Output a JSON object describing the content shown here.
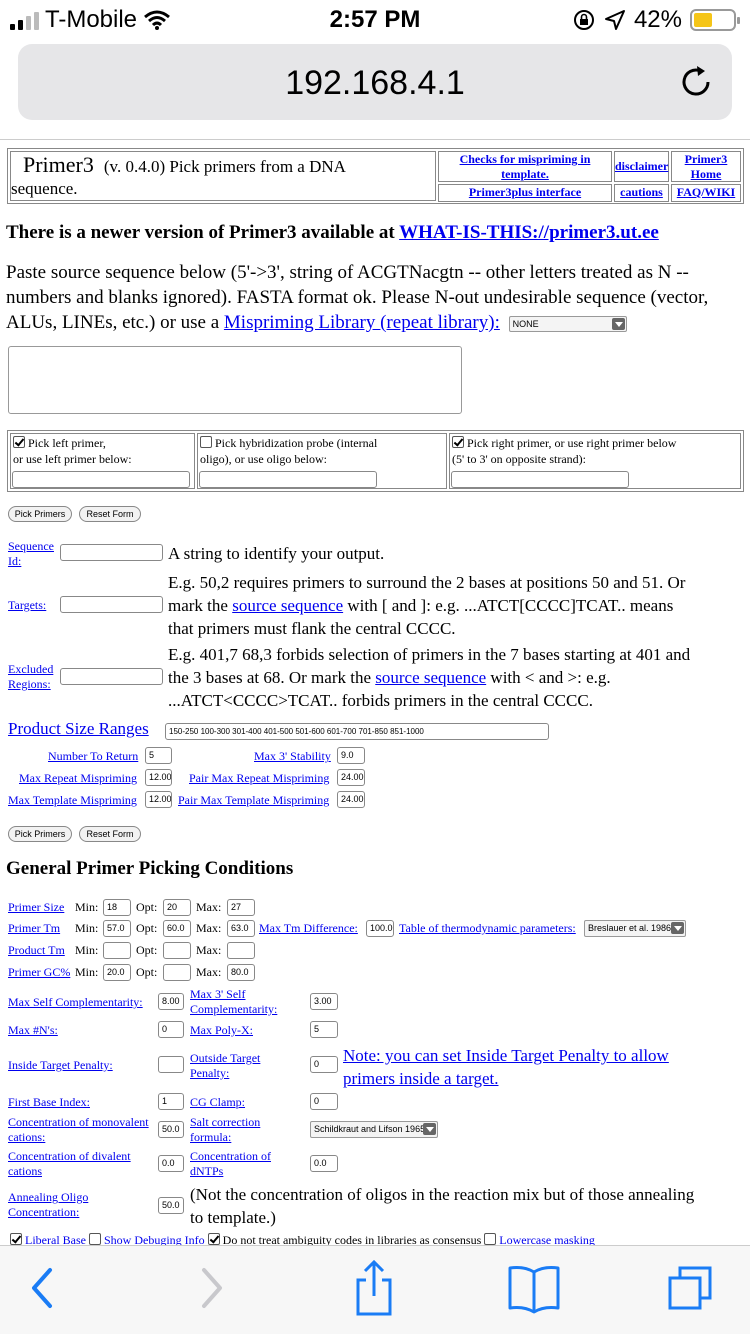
{
  "status": {
    "carrier": "T-Mobile",
    "time": "2:57 PM",
    "battery": "42%",
    "battery_level": 0.42
  },
  "browser": {
    "url": "192.168.4.1"
  },
  "header": {
    "app": "Primer3",
    "version": "(v. 0.4.0) Pick primers from a DNA",
    "version2": "sequence.",
    "link_mispriming": "Checks for mispriming in template.",
    "link_disclaimer": "disclaimer",
    "link_home": "Primer3 Home",
    "link_plus": "Primer3plus interface",
    "link_cautions": "cautions",
    "link_faq": "FAQ/WIKI"
  },
  "notice": {
    "text": "There is a newer version of Primer3 available at ",
    "link": "WHAT-IS-THIS://primer3.ut.ee"
  },
  "paste": {
    "text": "Paste source sequence below (5'->3', string of ACGTNacgtn -- other letters treated as N -- numbers and blanks ignored). FASTA format ok. Please N-out undesirable sequence (vector, ALUs, LINEs, etc.) or use a ",
    "link": "Mispriming Library (repeat library):",
    "library_value": "NONE"
  },
  "pick": {
    "left_a": "Pick left primer,",
    "left_b": "or use left primer below:",
    "probe_a": "Pick hybridization probe (internal",
    "probe_b": "oligo), or use oligo below:",
    "right_a": "Pick right primer, or use right primer below",
    "right_b": "(5' to 3' on opposite strand):"
  },
  "buttons": {
    "pick": "Pick Primers",
    "reset": "Reset Form"
  },
  "seq_id": {
    "label_a": "Sequence",
    "label_b": "Id:",
    "desc": "A string to identify your output."
  },
  "targets": {
    "label": "Targets:",
    "d1": "E.g. 50,2 requires primers to surround the 2 bases at positions 50 and 51. Or",
    "d2a": "mark the ",
    "d2link": "source sequence",
    "d2b": " with [ and ]: e.g. ...ATCT[CCCC]TCAT.. means",
    "d3": "that primers must flank the central CCCC."
  },
  "excluded": {
    "label_a": "Excluded",
    "label_b": "Regions:",
    "d1": "E.g. 401,7 68,3 forbids selection of primers in the 7 bases starting at 401 and",
    "d2a": "the 3 bases at 68. Or mark the ",
    "d2link": "source sequence",
    "d2b": " with < and >: e.g.",
    "d3": "...ATCT<CCCC>TCAT.. forbids primers in the central CCCC."
  },
  "product": {
    "label": "Product Size Ranges",
    "value": "150-250 100-300 301-400 401-500 501-600 601-700 701-850 851-1000"
  },
  "params": {
    "num_return": {
      "label": "Number To Return",
      "value": "5"
    },
    "max3stab": {
      "label": "Max 3' Stability",
      "value": "9.0"
    },
    "max_repeat": {
      "label": "Max Repeat Mispriming",
      "value": "12.00"
    },
    "pair_repeat": {
      "label": "Pair Max Repeat Mispriming",
      "value": "24.00"
    },
    "max_template": {
      "label": "Max Template Mispriming",
      "value": "12.00"
    },
    "pair_template": {
      "label": "Pair Max Template Mispriming",
      "value": "24.00"
    }
  },
  "general": {
    "title": "General Primer Picking Conditions",
    "min": "Min:",
    "opt": "Opt:",
    "max": "Max:",
    "size": {
      "label": "Primer Size",
      "min": "18",
      "opt": "20",
      "max": "27"
    },
    "tm": {
      "label": "Primer Tm",
      "min": "57.0",
      "opt": "60.0",
      "max": "63.0"
    },
    "tmdiff": {
      "label": "Max Tm Difference:",
      "value": "100.0"
    },
    "thermo": {
      "label": "Table of thermodynamic parameters:",
      "value": "Breslauer et al. 1986"
    },
    "prodtm": {
      "label": "Product Tm",
      "min": "",
      "opt": "",
      "max": ""
    },
    "gc": {
      "label": "Primer GC%",
      "min": "20.0",
      "opt": "",
      "max": "80.0"
    },
    "selfcomp": {
      "label": "Max Self Complementarity:",
      "value": "8.00"
    },
    "self3": {
      "label_a": "Max 3' Self",
      "label_b": "Complementarity:",
      "value": "3.00"
    },
    "maxn": {
      "label": "Max #N's:",
      "value": "0"
    },
    "polyx": {
      "label": "Max Poly-X:",
      "value": "5"
    },
    "inside": {
      "label": "Inside Target Penalty:",
      "value": ""
    },
    "outside": {
      "label_a": "Outside Target",
      "label_b": "Penalty:",
      "value": "0"
    },
    "note_a": "Note: you can set Inside Target Penalty to allow",
    "note_b": "primers inside a target.",
    "firstbase": {
      "label": "First Base Index:",
      "value": "1"
    },
    "gcclamp": {
      "label": "CG Clamp:",
      "value": "0"
    },
    "monov": {
      "label_a": "Concentration of monovalent",
      "label_b": "cations:",
      "value": "50.0"
    },
    "saltcorr": {
      "label_a": "Salt correction",
      "label_b": "formula:",
      "value": "Schildkraut and Lifson 1965"
    },
    "div": {
      "label_a": "Concentration of divalent",
      "label_b": "cations",
      "value": "0.0"
    },
    "dntp": {
      "label_a": "Concentration of",
      "label_b": "dNTPs",
      "value": "0.0"
    },
    "anneal": {
      "label_a": "Annealing Oligo",
      "label_b": "Concentration:",
      "value": "50.0"
    },
    "anneal_note_a": "(Not the concentration of oligos in the reaction mix but of those annealing",
    "anneal_note_b": "to template.)",
    "opt_liberal": "Liberal Base",
    "opt_debug": "Show Debuging Info",
    "opt_ambig": "Do not treat ambiguity codes in libraries as consensus",
    "opt_lower": "Lowercase masking"
  }
}
